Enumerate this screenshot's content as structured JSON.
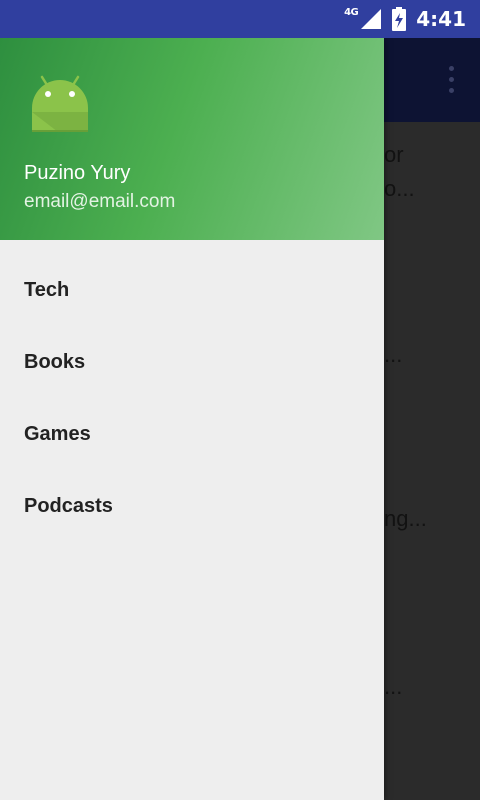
{
  "status_bar": {
    "network_type": "4G",
    "time": "4:41"
  },
  "background": {
    "peek_lines": [
      "or",
      "o...",
      "...",
      "ng...",
      "..."
    ]
  },
  "drawer": {
    "user_name": "Puzino Yury",
    "user_email": "email@email.com",
    "menu_items": [
      "Tech",
      "Books",
      "Games",
      "Podcasts"
    ]
  },
  "colors": {
    "status_bar": "#303f9f",
    "header_start": "#2e8f3f",
    "header_end": "#80c784",
    "drawer_bg": "#eeeeee",
    "android_green": "#8bc34a"
  },
  "icons": [
    "signal-icon",
    "battery-icon",
    "android-avatar-icon",
    "overflow-menu-icon"
  ]
}
